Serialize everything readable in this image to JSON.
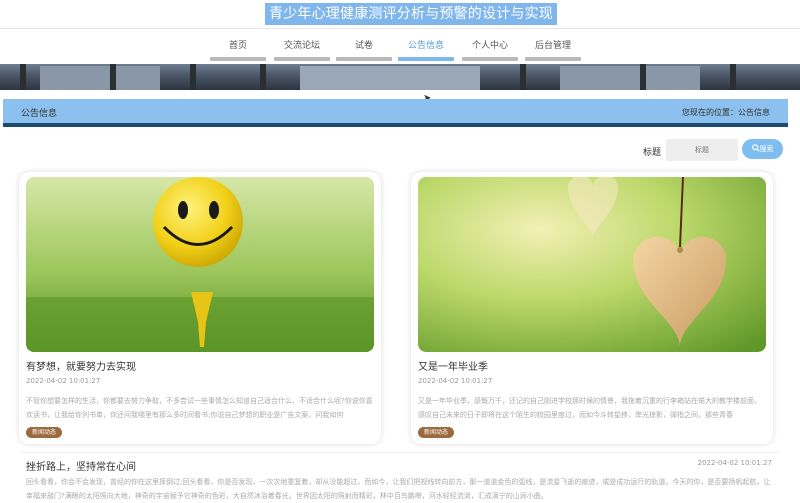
{
  "site": {
    "title": "青少年心理健康测评分析与预警的设计与实现"
  },
  "nav": {
    "items": [
      {
        "label": "首页",
        "active": false
      },
      {
        "label": "交流论坛",
        "active": false
      },
      {
        "label": "试卷",
        "active": false
      },
      {
        "label": "公告信息",
        "active": true
      },
      {
        "label": "个人中心",
        "active": false
      },
      {
        "label": "后台管理",
        "active": false
      }
    ]
  },
  "section": {
    "title": "公告信息",
    "location_prefix": "您现在的位置：",
    "location_current": "公告信息"
  },
  "search": {
    "label": "标题",
    "placeholder": "标题",
    "button_label": "搜索",
    "button_icon": "search-icon"
  },
  "cards": [
    {
      "title": "有梦想，就要努力去实现",
      "date": "2022-04-02 10:01:27",
      "description": "不管你想要怎样的生活，你都要去努力争取，不多尝试一些事情怎么知道自己适合什么、不适合什么呢?你说你喜欢读书，让我给你列书单，你还问我哪里有那么多时间看书;你说自己梦想的职业是广告文案，问我如何",
      "tag": "新闻动态",
      "image": "smiley-golf-ball"
    },
    {
      "title": "又是一年毕业季",
      "date": "2022-04-02 10:01:27",
      "description": "又是一年毕业季，感慨万千，还记的自己刚进学校那时候的情景，我拖着沉重的行李箱站在偌大的教学楼前面，感叹自己未来的日子即将在这个陌生的校园里度过，而如今斗转星移，岸光掠影，弹指之间，那些青春",
      "tag": "新闻动态",
      "image": "wooden-heart"
    }
  ],
  "list": [
    {
      "title": "挫折路上，坚持常在心间",
      "date": "2022-04-02 10:01:27",
      "description": "回头看看，你会不会发现，曾经的你在这里摔倒过;回头看看，你是否发现，一次次地重复着，却从没能超过。而如今，让我们把视线转向前方，那一道道金色的弧线，是流星飞逝的痕迹，或是成功运行的轨道。今天的你，是否要扬帆起航，让幸福来敲门?满眼的太阳照向大地，神奇的宇宙赋予它神奇的色彩，大自然沐浴着春光，世界因太阳的照射而精彩，林中百鸟鹏啭，河水轻轻流淌，汇成滴宁的山涧小曲。"
    }
  ],
  "colors": {
    "accent": "#7fb6ec",
    "section_bar": "#8cc0ee",
    "section_border": "#1d4a73",
    "tag": "#9c6b3d"
  }
}
